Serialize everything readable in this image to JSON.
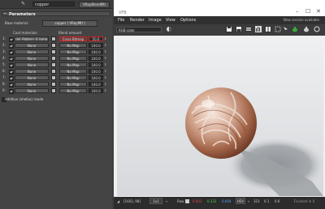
{
  "material_editor": {
    "material_name": "copper",
    "material_type": "VRayBlendMtl",
    "rollout_title": "Parameters",
    "base_material_label": "Base material:",
    "base_material_value": "copper   ( VRayMtl )",
    "coat_header": "Coat materials:",
    "blend_header": "Blend amount:",
    "rows": [
      {
        "index": "1:",
        "coat": "tiel_Pattern_4_Jamp_3",
        "mask": "Cross Bitmap",
        "amount": "50.0",
        "checked": true,
        "highlight": true
      },
      {
        "index": "2:",
        "coat": "None",
        "mask": "No Map",
        "amount": "100.0",
        "checked": true,
        "highlight": false
      },
      {
        "index": "3:",
        "coat": "None",
        "mask": "No Map",
        "amount": "100.0",
        "checked": true,
        "highlight": false
      },
      {
        "index": "4:",
        "coat": "None",
        "mask": "No Map",
        "amount": "100.0",
        "checked": true,
        "highlight": false
      },
      {
        "index": "5:",
        "coat": "None",
        "mask": "No Map",
        "amount": "100.0",
        "checked": true,
        "highlight": false
      },
      {
        "index": "6:",
        "coat": "None",
        "mask": "No Map",
        "amount": "100.0",
        "checked": true,
        "highlight": false
      },
      {
        "index": "7:",
        "coat": "None",
        "mask": "No Map",
        "amount": "100.0",
        "checked": true,
        "highlight": false
      },
      {
        "index": "8:",
        "coat": "None",
        "mask": "No Map",
        "amount": "100.0",
        "checked": true,
        "highlight": false
      },
      {
        "index": "9:",
        "coat": "None",
        "mask": "No Map",
        "amount": "100.0",
        "checked": true,
        "highlight": false
      }
    ],
    "additive_label": "Additive (shellac) mode"
  },
  "vfb": {
    "title": "VFB",
    "menu": [
      "File",
      "Render",
      "Image",
      "View",
      "Options"
    ],
    "new_version": "New version available",
    "color_channel": "RGB color",
    "status": {
      "coords": "[1602, 98]",
      "zoom": "1x1",
      "raw_label": "Raw",
      "r": "0.602",
      "g": "0.333",
      "b": "0.604",
      "hsv_label": "HSV",
      "h": "321",
      "s": "0.1",
      "v": "0.6",
      "state": "Finished in 0"
    },
    "colors": {
      "r": "#e04a4a",
      "g": "#4ad04a",
      "b": "#5aa0ff",
      "highlight": "#d02020"
    }
  }
}
